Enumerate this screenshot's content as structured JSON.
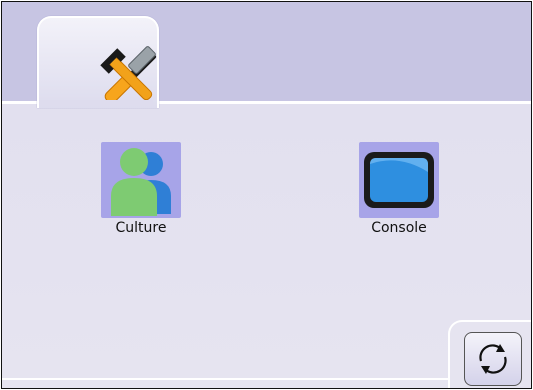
{
  "tabs": [
    {
      "icon": "tools-icon",
      "label": ""
    }
  ],
  "apps": [
    {
      "icon": "users-icon",
      "label": "Culture"
    },
    {
      "icon": "monitor-icon",
      "label": "Console"
    }
  ],
  "actions": {
    "sync_icon": "sync-icon"
  },
  "colors": {
    "background": "#e6e4f0",
    "header": "#c7c5e3",
    "tile": "#a7a4e8"
  }
}
